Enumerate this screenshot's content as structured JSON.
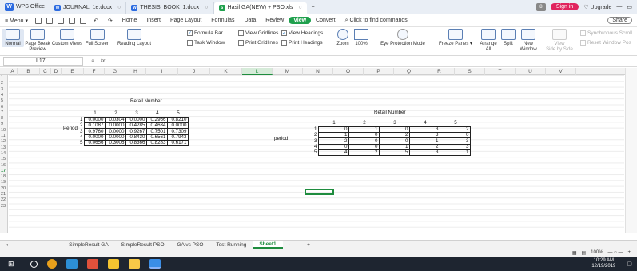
{
  "titlebar": {
    "app_name": "WPS Office",
    "tabs": [
      {
        "label": "JOURNAL_1e.docx",
        "color": "#2c6be0"
      },
      {
        "label": "THESIS_BOOK_1.docx",
        "color": "#2c6be0"
      },
      {
        "label": "Hasil GA(NEW) + PSO.xls",
        "color": "#1fa04d"
      }
    ],
    "badge": "8",
    "sign_in": "Sign in",
    "upgrade": "Upgrade"
  },
  "menubar": {
    "menu": "Menu",
    "items": [
      "Home",
      "Insert",
      "Page Layout",
      "Formulas",
      "Data",
      "Review",
      "View",
      "Convert",
      "Click to find commands"
    ],
    "share": "Share"
  },
  "ribbon": {
    "normal": "Normal",
    "page_break": "Page Break\nPreview",
    "custom_views": "Custom Views",
    "full_screen": "Full Screen",
    "reading_layout": "Reading Layout",
    "formula_bar": "Formula Bar",
    "task_window": "Task Window",
    "view_gridlines": "View Gridlines",
    "print_gridlines": "Print Gridlines",
    "view_headings": "View Headings",
    "print_headings": "Print Headings",
    "zoom": "Zoom",
    "zoom_100": "100%",
    "eye_protection": "Eye Protection Mode",
    "freeze_panes": "Freeze Panes",
    "arrange_all": "Arrange\nAll",
    "split": "Split",
    "new_window": "New\nWindow",
    "side_by_side": "View\nSide by Side",
    "sync_scroll": "Synchronous Scroll",
    "reset_window": "Reset Window Pos"
  },
  "formula": {
    "cell_ref": "L17",
    "fx": "fx"
  },
  "columns": [
    "A",
    "B",
    "C",
    "D",
    "E",
    "F",
    "G",
    "H",
    "I",
    "J",
    "K",
    "L",
    "M",
    "N",
    "O",
    "P",
    "Q",
    "R",
    "S",
    "T",
    "U",
    "V"
  ],
  "rows": [
    "1",
    "2",
    "3",
    "4",
    "5",
    "6",
    "7",
    "8",
    "9",
    "10",
    "11",
    "12",
    "13",
    "14",
    "15",
    "16",
    "17",
    "18",
    "19",
    "20",
    "21",
    "22",
    "23"
  ],
  "left_table": {
    "title": "Retail Number",
    "row_label": "Period",
    "col_headers": [
      "1",
      "2",
      "3",
      "4",
      "5"
    ],
    "row_headers": [
      "1",
      "2",
      "3",
      "4",
      "5"
    ],
    "cells": [
      [
        "0.0000",
        "0.0304",
        "0.0000",
        "0.2966",
        "0.8210"
      ],
      [
        "0.1087",
        "0.0000",
        "0.4285",
        "0.4634",
        "0.0000"
      ],
      [
        "0.9760",
        "0.0000",
        "0.9267",
        "0.7501",
        "0.7309"
      ],
      [
        "0.0000",
        "0.0000",
        "0.8430",
        "0.6561",
        "0.7943"
      ],
      [
        "0.0656",
        "0.3006",
        "0.8366",
        "0.8283",
        "0.6171"
      ]
    ]
  },
  "right_table": {
    "title": "Retail Number",
    "row_label": "period",
    "col_headers": [
      "1",
      "2",
      "3",
      "4",
      "5"
    ],
    "row_headers": [
      "1",
      "2",
      "3",
      "4",
      "5"
    ],
    "cells": [
      [
        "0",
        "1",
        "0",
        "3",
        "2"
      ],
      [
        "1",
        "0",
        "2",
        "3",
        "0"
      ],
      [
        "2",
        "0",
        "0",
        "1",
        "3"
      ],
      [
        "0",
        "0",
        "1",
        "2",
        "3"
      ],
      [
        "4",
        "2",
        "5",
        "3",
        "1"
      ]
    ]
  },
  "sheet_tabs": [
    "SimpleResult GA",
    "SimpleResult PSO",
    "GA vs PSO",
    "Test Running",
    "Sheet1"
  ],
  "active_sheet": "Sheet1",
  "status": {
    "zoom": "100%"
  },
  "clock": {
    "time": "10:29 AM",
    "date": "12/19/2019"
  }
}
